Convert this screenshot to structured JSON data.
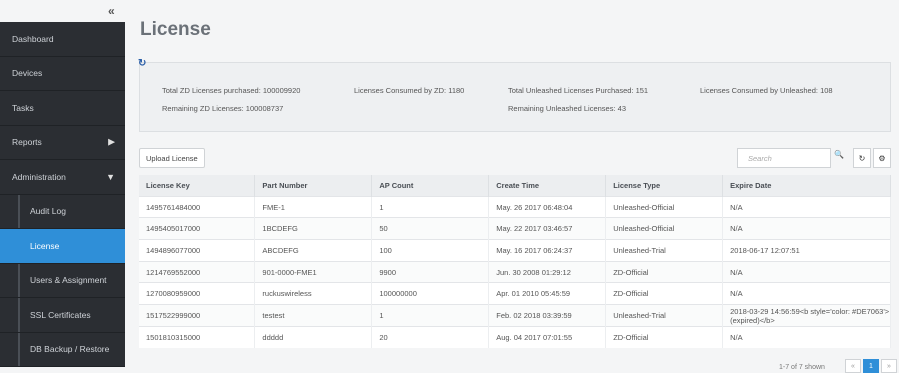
{
  "sidebar": {
    "collapse_glyph": "«",
    "items": [
      {
        "label": "Dashboard"
      },
      {
        "label": "Devices"
      },
      {
        "label": "Tasks"
      },
      {
        "label": "Reports",
        "arrow": "▶"
      },
      {
        "label": "Administration",
        "arrow": "▼"
      },
      {
        "label": "Audit Log"
      },
      {
        "label": "License",
        "active": true
      },
      {
        "label": "Users & Assignment"
      },
      {
        "label": "SSL Certificates"
      },
      {
        "label": "DB Backup / Restore"
      }
    ]
  },
  "page": {
    "title": "License"
  },
  "summary": {
    "refresh_glyph": "↻",
    "total_zd": "Total ZD Licenses purchased: 100009920",
    "consumed_zd": "Licenses Consumed by ZD: 1180",
    "total_unleashed": "Total Unleashed Licenses Purchased: 151",
    "consumed_unleashed": "Licenses Consumed by Unleashed: 108",
    "remaining_zd": "Remaining ZD Licenses: 100008737",
    "remaining_unleashed": "Remaining Unleashed Licenses: 43"
  },
  "toolbar": {
    "upload_label": "Upload License",
    "search_placeholder": "Search",
    "search_glyph": "🔍",
    "refresh_glyph": "↻",
    "settings_glyph": "⚙"
  },
  "table": {
    "columns": [
      "License Key",
      "Part Number",
      "AP Count",
      "Create Time",
      "License Type",
      "Expire Date"
    ],
    "rows": [
      [
        "1495761484000",
        "FME-1",
        "1",
        "May. 26 2017 06:48:04",
        "Unleashed-Official",
        "N/A"
      ],
      [
        "1495405017000",
        "1BCDEFG",
        "50",
        "May. 22 2017 03:46:57",
        "Unleashed-Official",
        "N/A"
      ],
      [
        "1494896077000",
        "ABCDEFG",
        "100",
        "May. 16 2017 06:24:37",
        "Unleashed-Trial",
        "2018-06-17 12:07:51"
      ],
      [
        "1214769552000",
        "901-0000-FME1",
        "9900",
        "Jun. 30 2008 01:29:12",
        "ZD-Official",
        "N/A"
      ],
      [
        "1270080959000",
        "ruckuswireless",
        "100000000",
        "Apr. 01 2010 05:45:59",
        "ZD-Official",
        "N/A"
      ],
      [
        "1517522999000",
        "testest",
        "1",
        "Feb. 02 2018 03:39:59",
        "Unleashed-Trial",
        "2018-03-29 14:56:59<b style='color: #DE7063'>(expired)</b>"
      ],
      [
        "1501810315000",
        "ddddd",
        "20",
        "Aug. 04 2017 07:01:55",
        "ZD-Official",
        "N/A"
      ]
    ]
  },
  "pager": {
    "summary": "1-7 of 7 shown",
    "prev": "«",
    "page": "1",
    "next": "»"
  }
}
